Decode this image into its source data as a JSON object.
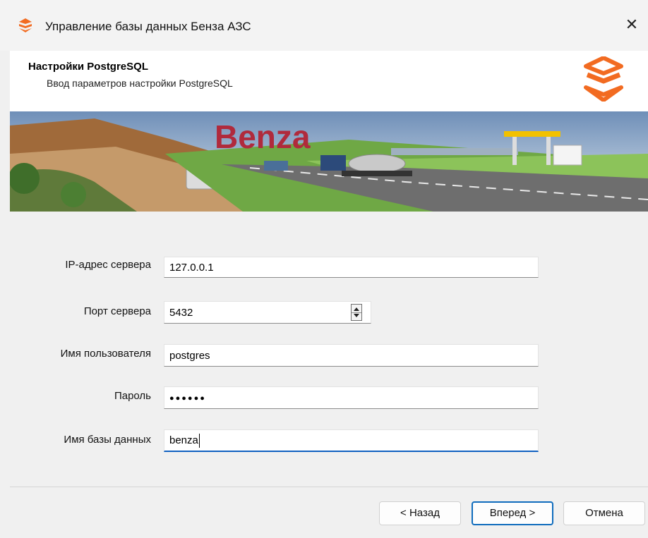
{
  "window": {
    "title": "Управление базы данных Бенза АЗС",
    "close_label": "✕",
    "accent_color": "#f26b21"
  },
  "header": {
    "title": "Настройки PostgreSQL",
    "subtitle": "Ввод параметров настройки PostgreSQL"
  },
  "banner": {
    "brand_text": "Benza"
  },
  "form": {
    "server_ip": {
      "label": "IP-адрес сервера",
      "value": "127.0.0.1"
    },
    "server_port": {
      "label": "Порт сервера",
      "value": "5432"
    },
    "username": {
      "label": "Имя пользователя",
      "value": "postgres"
    },
    "password": {
      "label": "Пароль",
      "value": "●●●●●●"
    },
    "database": {
      "label": "Имя базы данных",
      "value": "benza"
    }
  },
  "footer": {
    "back_label": "< Назад",
    "next_label": "Вперед >",
    "cancel_label": "Отмена"
  }
}
